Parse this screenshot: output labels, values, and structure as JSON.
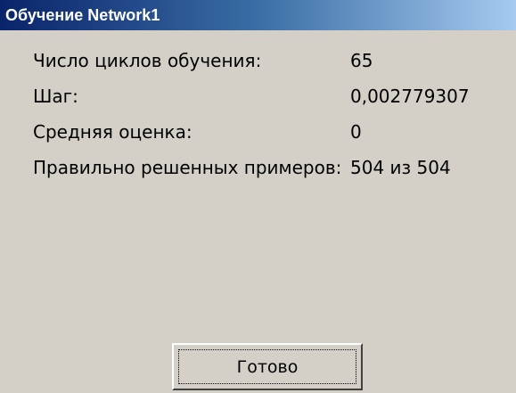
{
  "window": {
    "title": "Обучение Network1"
  },
  "stats": [
    {
      "label": "Число циклов обучения:",
      "value": "65"
    },
    {
      "label": "Шаг:",
      "value": "0,002779307"
    },
    {
      "label": "Средняя оценка:",
      "value": "0"
    },
    {
      "label": "Правильно решенных примеров:",
      "value": "504 из 504"
    }
  ],
  "buttons": {
    "done_label": "Готово"
  },
  "colors": {
    "dialog_bg": "#d4d0c8",
    "titlebar_start": "#0a246a",
    "titlebar_end": "#a6caf0",
    "title_text": "#ffffff"
  }
}
